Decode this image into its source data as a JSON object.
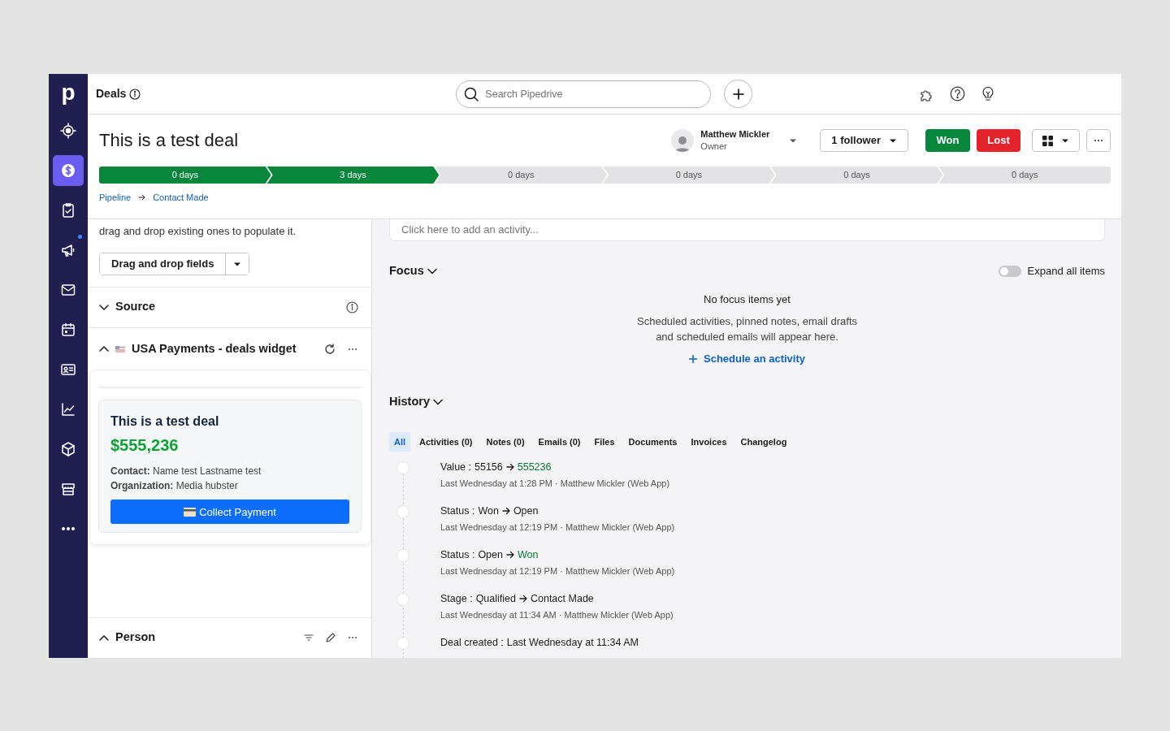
{
  "app": {
    "logo": "p",
    "nav": [
      {
        "selected": false,
        "notification": false
      },
      {
        "selected": true,
        "notification": false
      },
      {
        "selected": false,
        "notification": false
      },
      {
        "selected": false,
        "notification": true
      },
      {
        "selected": false,
        "notification": false
      },
      {
        "selected": false,
        "notification": false
      },
      {
        "selected": false,
        "notification": false
      },
      {
        "selected": false,
        "notification": false
      },
      {
        "selected": false,
        "notification": false
      },
      {
        "selected": false,
        "notification": false
      },
      {
        "selected": false,
        "notification": false
      }
    ]
  },
  "topbar": {
    "title": "Deals",
    "search": {
      "placeholder": "Search Pipedrive"
    }
  },
  "deal": {
    "title": "This is a test deal",
    "owner": {
      "name": "Matthew Mickler",
      "role": "Owner"
    },
    "followers": "1 follower",
    "won": "Won",
    "lost": "Lost",
    "stages": [
      {
        "label": "0 days",
        "done": true
      },
      {
        "label": "3 days",
        "done": true
      },
      {
        "label": "0 days",
        "done": false
      },
      {
        "label": "0 days",
        "done": false
      },
      {
        "label": "0 days",
        "done": false
      },
      {
        "label": "0 days",
        "done": false
      }
    ],
    "breadcrumb": [
      "Pipeline",
      "Contact Made"
    ]
  },
  "left": {
    "hint": "drag and drop existing ones to populate it.",
    "fields_button": "Drag and drop fields",
    "sections": [
      {
        "kind": "source",
        "title": "Source",
        "expanded": false
      },
      {
        "kind": "widget",
        "title": "USA Payments - deals widget",
        "expanded": true,
        "card": {
          "title": "This is a test deal",
          "amount": "$555,236",
          "details": [
            "**Contact:** Name test Lastname test",
            "**Organization:** Media hubster"
          ],
          "button": "Collect Payment"
        }
      },
      {
        "kind": "person",
        "title": "Person",
        "expanded": true
      }
    ]
  },
  "right": {
    "activity_placeholder": "Click here to add an activity...",
    "focus": {
      "title": "Focus",
      "expand_all": {
        "label": "Expand all items",
        "on": false
      },
      "empty_title": "No focus items yet",
      "empty_text": "Scheduled activities, pinned notes, email drafts and scheduled emails will appear here.",
      "action": "Schedule an activity"
    },
    "history": {
      "title": "History",
      "filters": [
        {
          "label": "All",
          "selected": true
        },
        {
          "label": "Activities (0)",
          "selected": false
        },
        {
          "label": "Notes (0)",
          "selected": false
        },
        {
          "label": "Emails (0)",
          "selected": false
        },
        {
          "label": "Files",
          "selected": false
        },
        {
          "label": "Documents",
          "selected": false
        },
        {
          "label": "Invoices",
          "selected": false
        },
        {
          "label": "Changelog",
          "selected": false
        }
      ],
      "entries": [
        {
          "kind": "change",
          "field": "Value :",
          "from": "55156",
          "to": "555236",
          "to_highlight": true,
          "meta": "Last Wednesday at 1:28 PM · Matthew Mickler (Web App)"
        },
        {
          "kind": "change",
          "field": "Status :",
          "from": "Won",
          "to": "Open",
          "to_highlight": false,
          "meta": "Last Wednesday at 12:19 PM · Matthew Mickler (Web App)"
        },
        {
          "kind": "change",
          "field": "Status :",
          "from": "Open",
          "to": "Won",
          "to_highlight": true,
          "meta": "Last Wednesday at 12:19 PM · Matthew Mickler (Web App)"
        },
        {
          "kind": "change",
          "field": "Stage :",
          "from": "Qualified",
          "to": "Contact Made",
          "to_highlight": false,
          "meta": "Last Wednesday at 11:34 AM · Matthew Mickler (Web App)"
        },
        {
          "kind": "created",
          "field": "Deal created :",
          "value": "Last Wednesday at 11:34 AM"
        }
      ]
    }
  }
}
